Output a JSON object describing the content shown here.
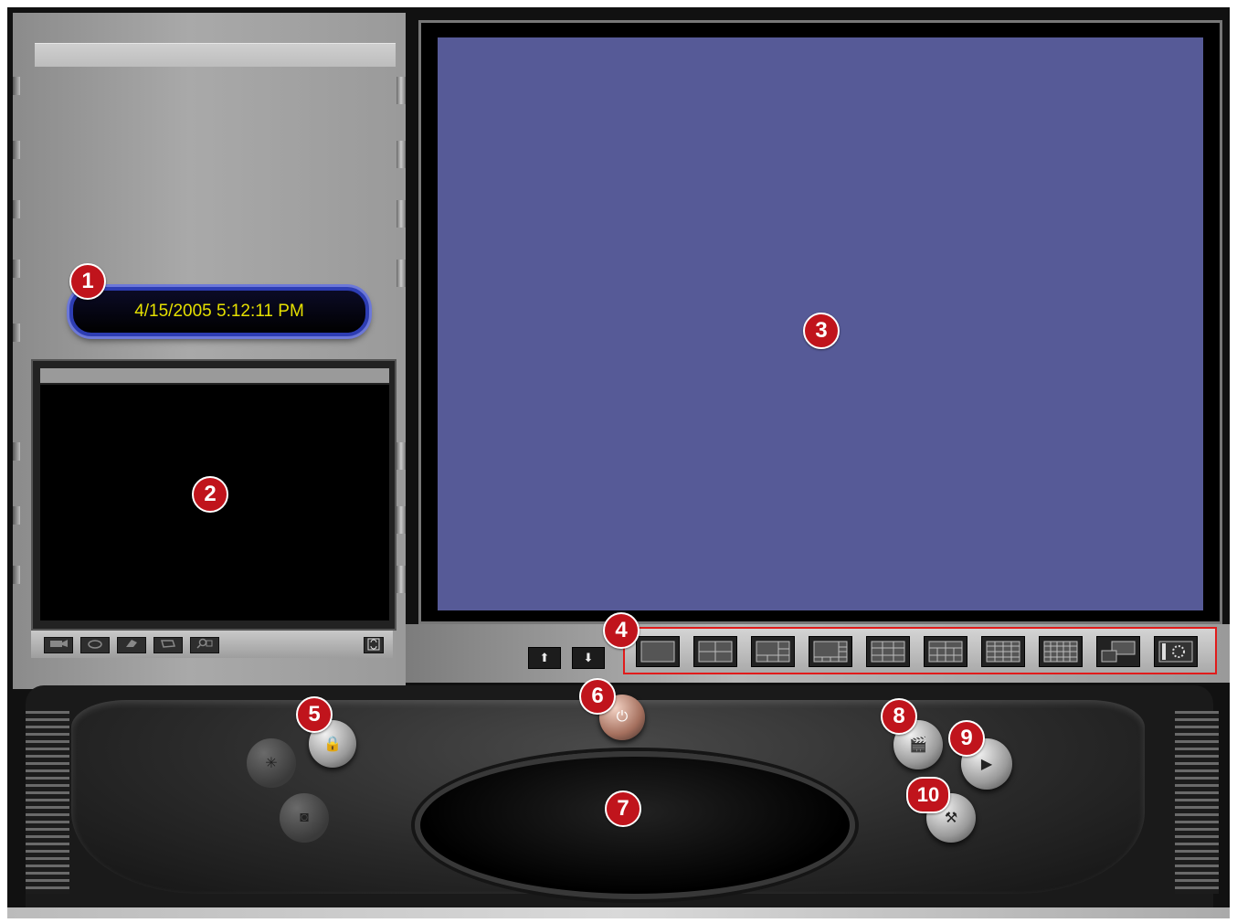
{
  "clock": {
    "datetime": "4/15/2005 5:12:11 PM"
  },
  "camera_toolbar": {
    "buttons": [
      {
        "icon": "camera-icon"
      },
      {
        "icon": "ptz-icon"
      },
      {
        "icon": "settings-icon"
      },
      {
        "icon": "folder-icon"
      },
      {
        "icon": "search-icon"
      }
    ],
    "refresh_icon": "refresh-icon"
  },
  "navigation": {
    "up_label": "⬆",
    "down_label": "⬇"
  },
  "layouts": [
    {
      "name": "layout-1x1"
    },
    {
      "name": "layout-2x2"
    },
    {
      "name": "layout-1-plus-5"
    },
    {
      "name": "layout-1-plus-7"
    },
    {
      "name": "layout-3x3"
    },
    {
      "name": "layout-1-plus-12"
    },
    {
      "name": "layout-4x4-alt"
    },
    {
      "name": "layout-4x4"
    },
    {
      "name": "layout-pip"
    },
    {
      "name": "layout-sequence"
    }
  ],
  "callouts": [
    "1",
    "2",
    "3",
    "4",
    "5",
    "6",
    "7",
    "8",
    "9",
    "10"
  ],
  "console": {
    "lock_glyph": "🔒",
    "power_glyph": "⏻",
    "network_glyph": "✳",
    "camera_glyph": "◙",
    "record_glyph": "🎬",
    "play_glyph": "▶",
    "tools_glyph": "⚒"
  },
  "colors": {
    "clock_text": "#e5e000",
    "video_bg": "#565a97",
    "callout": "#c0141c",
    "layout_border": "#e11b1b"
  }
}
